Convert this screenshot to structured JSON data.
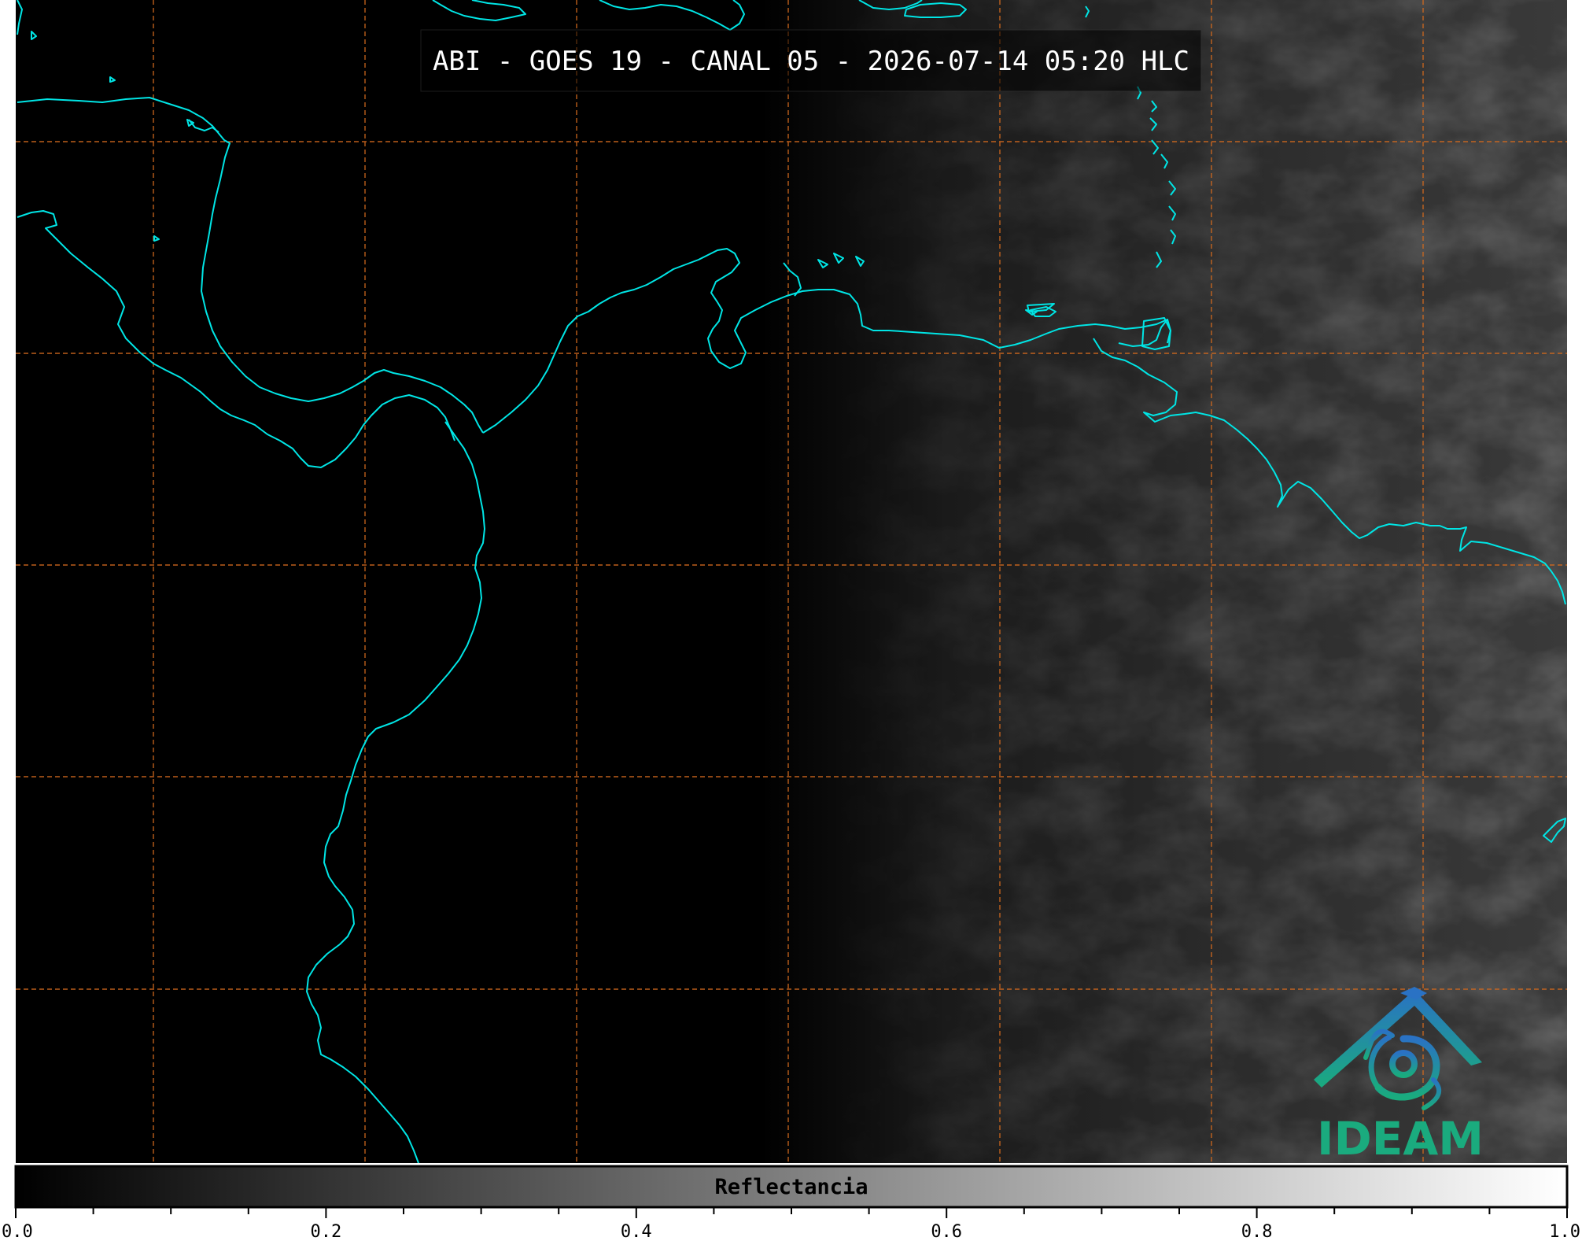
{
  "title": "ABI - GOES 19 - CANAL 05 - 2026-07-14 05:20 HLC",
  "colorbar": {
    "label": "Reflectancia",
    "ticks": [
      "0.0",
      "0.2",
      "0.4",
      "0.6",
      "0.8",
      "1.0"
    ],
    "range": [
      0.0,
      1.0
    ],
    "gradient": [
      "#000000",
      "#ffffff"
    ]
  },
  "logo": {
    "text": "IDEAM"
  },
  "colors": {
    "coastline": "#00e5e5",
    "gridline": "#d2691e",
    "background": "#000000"
  }
}
